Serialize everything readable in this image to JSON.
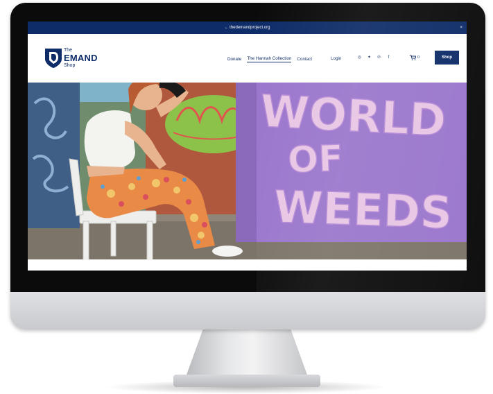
{
  "announcement": {
    "text": "← thedemandproject.org",
    "close": "×"
  },
  "logo": {
    "line1": "The",
    "line2": "EMAND",
    "line3": "Shop"
  },
  "nav": {
    "items": [
      {
        "label": "Donate"
      },
      {
        "label": "The Hannah Collection"
      },
      {
        "label": "Contact"
      }
    ],
    "login": "Login",
    "social": [
      {
        "name": "instagram-icon",
        "glyph": "◎"
      },
      {
        "name": "twitter-icon",
        "glyph": "✦"
      },
      {
        "name": "pinterest-icon",
        "glyph": "℗"
      },
      {
        "name": "facebook-icon",
        "glyph": "f"
      }
    ],
    "cart_count": "0",
    "shop_button": "Shop"
  },
  "hero": {
    "mural_lines": [
      "WORLD",
      "OF",
      "WEEDS"
    ]
  },
  "colors": {
    "brand": "#0e2c68",
    "mural_purple": "#9a76cc",
    "mural_letters": "#e7c6e4"
  }
}
